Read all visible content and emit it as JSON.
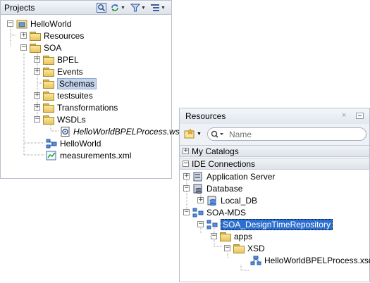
{
  "projects": {
    "title": "Projects",
    "tree": [
      {
        "label": "HelloWorld"
      },
      {
        "label": "Resources"
      },
      {
        "label": "SOA"
      },
      {
        "label": "BPEL"
      },
      {
        "label": "Events"
      },
      {
        "label": "Schemas"
      },
      {
        "label": "testsuites"
      },
      {
        "label": "Transformations"
      },
      {
        "label": "WSDLs"
      },
      {
        "label": "HelloWorldBPELProcess.wsdl"
      },
      {
        "label": "HelloWorld"
      },
      {
        "label": "measurements.xml"
      }
    ]
  },
  "resources": {
    "title": "Resources",
    "search_placeholder": "Name",
    "sections": {
      "my_catalogs": "My Catalogs",
      "ide_connections": "IDE Connections"
    },
    "tree": [
      {
        "label": "Application Server"
      },
      {
        "label": "Database"
      },
      {
        "label": "Local_DB"
      },
      {
        "label": "SOA-MDS"
      },
      {
        "label": "SOA_DesignTimeRepository"
      },
      {
        "label": "apps"
      },
      {
        "label": "XSD"
      },
      {
        "label": "HelloWorldBPELProcess.xsd"
      }
    ]
  }
}
